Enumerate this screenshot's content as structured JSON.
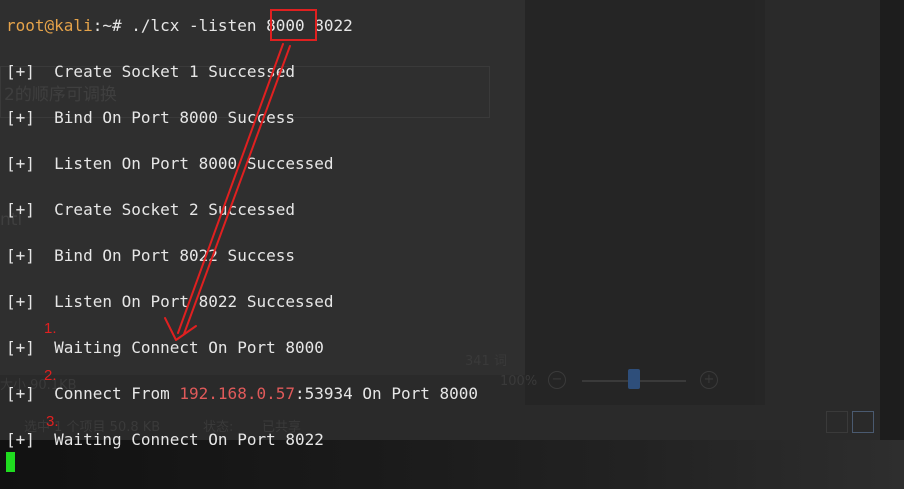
{
  "background": {
    "doc_text_1": "2的顺序可调换",
    "doc_text_2": "ntl",
    "word_count": "341 词",
    "file_size": "大小 90.1KB",
    "zoom": "100%",
    "status_bar": {
      "selected": "选中 1 个项目  50.8 KB",
      "state": "状态:",
      "shared": "已共享"
    }
  },
  "terminal": {
    "prompt_user": "root@kali",
    "prompt_path": ":~# ",
    "command_pre": "./lcx -listen ",
    "command_port": "8000",
    "command_post": " 8022",
    "lines": [
      "[+]  Create Socket 1 Successed",
      "[+]  Bind On Port 8000 Success",
      "[+]  Listen On Port 8000 Successed",
      "[+]  Create Socket 2 Successed",
      "[+]  Bind On Port 8022 Success",
      "[+]  Listen On Port 8022 Successed",
      "[+]  Waiting Connect On Port 8000"
    ],
    "connect_pre": "[+]  Connect From ",
    "connect_ip": "192.168.0.57",
    "connect_post": ":53934 On Port 8000",
    "last_line": "[+]  Waiting Connect On Port 8022"
  },
  "annotations": {
    "step1": "1.",
    "step2": "2.",
    "step3": "3.",
    "color": "#e02020"
  }
}
